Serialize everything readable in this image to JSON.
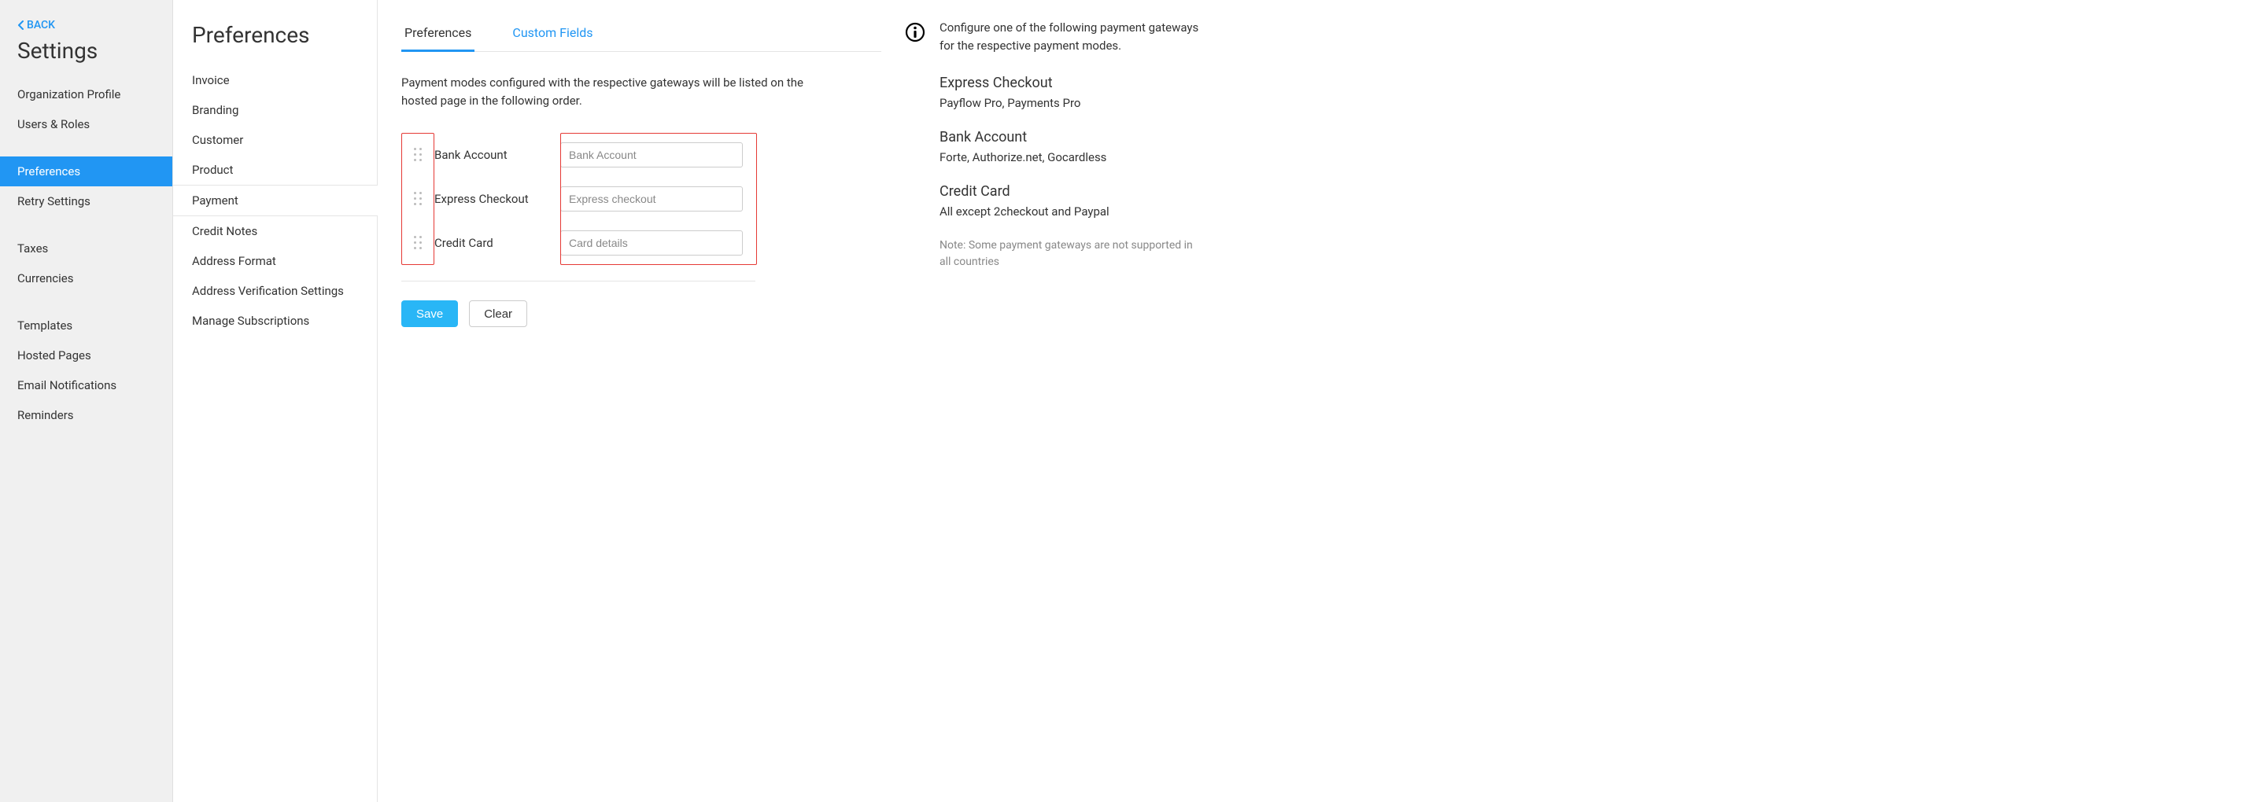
{
  "back_label": "BACK",
  "settings_title": "Settings",
  "settings_nav": {
    "group1": [
      "Organization Profile",
      "Users & Roles"
    ],
    "group2": [
      "Preferences",
      "Retry Settings"
    ],
    "group3": [
      "Taxes",
      "Currencies"
    ],
    "group4": [
      "Templates",
      "Hosted Pages",
      "Email Notifications",
      "Reminders"
    ],
    "active": "Preferences"
  },
  "prefs_title": "Preferences",
  "prefs_items": [
    "Invoice",
    "Branding",
    "Customer",
    "Product",
    "Payment",
    "Credit Notes",
    "Address Format",
    "Address Verification Settings",
    "Manage Subscriptions"
  ],
  "prefs_active": "Payment",
  "tabs": {
    "preferences": "Preferences",
    "custom_fields": "Custom Fields"
  },
  "intro": "Payment modes configured with the respective gateways will be listed on the hosted page in the following order.",
  "modes": [
    {
      "label": "Bank Account",
      "placeholder": "Bank Account"
    },
    {
      "label": "Express Checkout",
      "placeholder": "Express checkout"
    },
    {
      "label": "Credit Card",
      "placeholder": "Card details"
    }
  ],
  "buttons": {
    "save": "Save",
    "clear": "Clear"
  },
  "info": {
    "configure_text": "Configure one of the following payment gateways for the respective payment modes.",
    "blocks": [
      {
        "heading": "Express Checkout",
        "detail": "Payflow Pro, Payments Pro"
      },
      {
        "heading": "Bank Account",
        "detail": "Forte, Authorize.net, Gocardless"
      },
      {
        "heading": "Credit Card",
        "detail": "All except 2checkout and Paypal"
      }
    ],
    "note": "Note: Some payment gateways are not supported in all countries"
  }
}
